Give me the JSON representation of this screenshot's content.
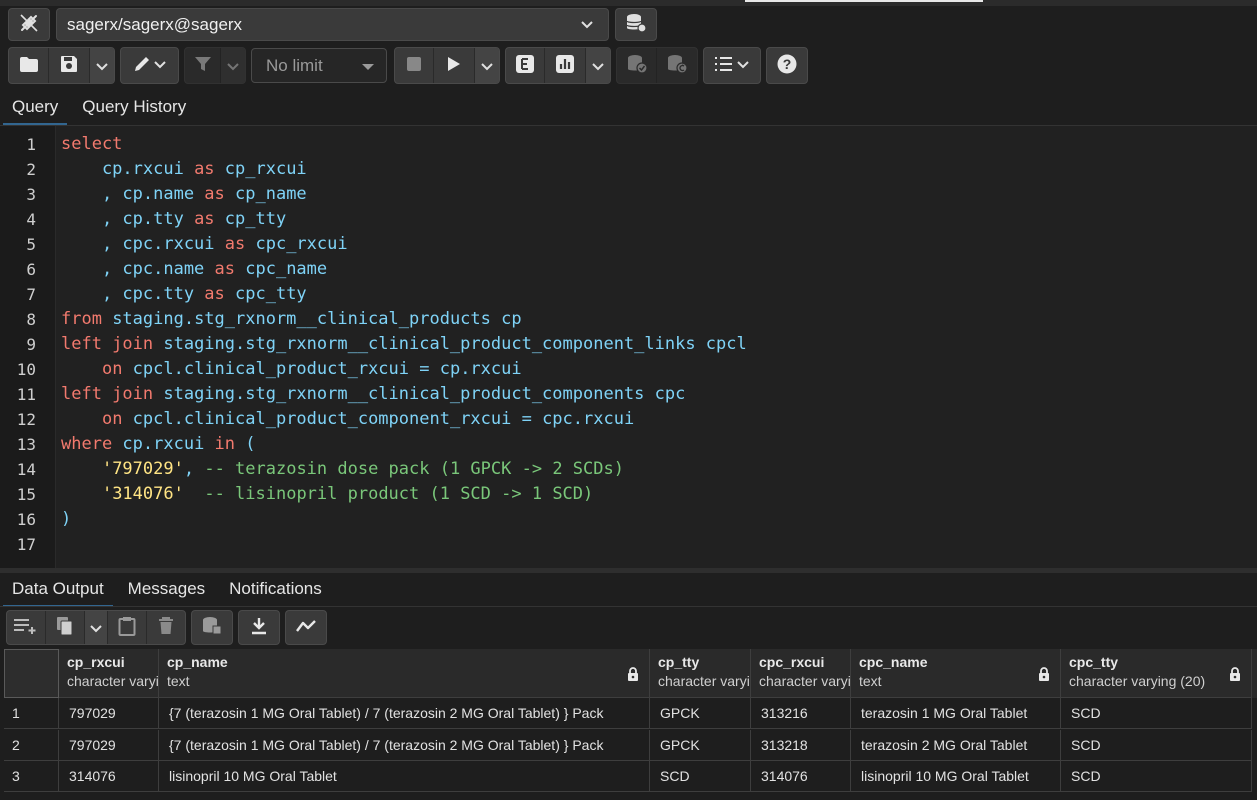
{
  "connection": {
    "label": "sagerx/sagerx@sagerx"
  },
  "toolbar": {
    "limit_label": "No limit"
  },
  "query_tabs": [
    {
      "label": "Query",
      "active": true
    },
    {
      "label": "Query History",
      "active": false
    }
  ],
  "editor": {
    "lines": [
      {
        "n": "1",
        "tokens": [
          {
            "t": "kw",
            "v": "select"
          }
        ]
      },
      {
        "n": "2",
        "tokens": [
          {
            "t": "code",
            "v": "    cp.rxcui "
          },
          {
            "t": "kw",
            "v": "as"
          },
          {
            "t": "code",
            "v": " cp_rxcui"
          }
        ]
      },
      {
        "n": "3",
        "tokens": [
          {
            "t": "code",
            "v": "    , cp.name "
          },
          {
            "t": "kw",
            "v": "as"
          },
          {
            "t": "code",
            "v": " cp_name"
          }
        ]
      },
      {
        "n": "4",
        "tokens": [
          {
            "t": "code",
            "v": "    , cp.tty "
          },
          {
            "t": "kw",
            "v": "as"
          },
          {
            "t": "code",
            "v": " cp_tty"
          }
        ]
      },
      {
        "n": "5",
        "tokens": [
          {
            "t": "code",
            "v": "    , cpc.rxcui "
          },
          {
            "t": "kw",
            "v": "as"
          },
          {
            "t": "code",
            "v": " cpc_rxcui"
          }
        ]
      },
      {
        "n": "6",
        "tokens": [
          {
            "t": "code",
            "v": "    , cpc.name "
          },
          {
            "t": "kw",
            "v": "as"
          },
          {
            "t": "code",
            "v": " cpc_name"
          }
        ]
      },
      {
        "n": "7",
        "tokens": [
          {
            "t": "code",
            "v": "    , cpc.tty "
          },
          {
            "t": "kw",
            "v": "as"
          },
          {
            "t": "code",
            "v": " cpc_tty"
          }
        ]
      },
      {
        "n": "8",
        "tokens": [
          {
            "t": "kw",
            "v": "from"
          },
          {
            "t": "code",
            "v": " staging.stg_rxnorm__clinical_products cp"
          }
        ]
      },
      {
        "n": "9",
        "tokens": [
          {
            "t": "kw",
            "v": "left join"
          },
          {
            "t": "code",
            "v": " staging.stg_rxnorm__clinical_product_component_links cpcl"
          }
        ]
      },
      {
        "n": "10",
        "tokens": [
          {
            "t": "code",
            "v": "    "
          },
          {
            "t": "kw",
            "v": "on"
          },
          {
            "t": "code",
            "v": " cpcl.clinical_product_rxcui = cp.rxcui"
          }
        ]
      },
      {
        "n": "11",
        "tokens": [
          {
            "t": "kw",
            "v": "left join"
          },
          {
            "t": "code",
            "v": " staging.stg_rxnorm__clinical_product_components cpc"
          }
        ]
      },
      {
        "n": "12",
        "tokens": [
          {
            "t": "code",
            "v": "    "
          },
          {
            "t": "kw",
            "v": "on"
          },
          {
            "t": "code",
            "v": " cpcl.clinical_product_component_rxcui = cpc.rxcui"
          }
        ]
      },
      {
        "n": "13",
        "tokens": [
          {
            "t": "kw",
            "v": "where"
          },
          {
            "t": "code",
            "v": " cp.rxcui "
          },
          {
            "t": "kw",
            "v": "in"
          },
          {
            "t": "code",
            "v": " ("
          }
        ]
      },
      {
        "n": "14",
        "tokens": [
          {
            "t": "code",
            "v": "    "
          },
          {
            "t": "str",
            "v": "'797029'"
          },
          {
            "t": "code",
            "v": ", "
          },
          {
            "t": "cm",
            "v": "-- terazosin dose pack (1 GPCK -> 2 SCDs)"
          }
        ]
      },
      {
        "n": "15",
        "tokens": [
          {
            "t": "code",
            "v": "    "
          },
          {
            "t": "str",
            "v": "'314076'"
          },
          {
            "t": "code",
            "v": "  "
          },
          {
            "t": "cm",
            "v": "-- lisinopril product (1 SCD -> 1 SCD)"
          }
        ]
      },
      {
        "n": "16",
        "tokens": [
          {
            "t": "code",
            "v": ")"
          }
        ]
      },
      {
        "n": "17",
        "tokens": []
      }
    ]
  },
  "result_tabs": [
    {
      "label": "Data Output",
      "active": true
    },
    {
      "label": "Messages",
      "active": false
    },
    {
      "label": "Notifications",
      "active": false
    }
  ],
  "grid": {
    "columns": [
      {
        "name": "cp_rxcui",
        "type": "character varying",
        "locked": false
      },
      {
        "name": "cp_name",
        "type": "text",
        "locked": true
      },
      {
        "name": "cp_tty",
        "type": "character varying",
        "locked": false
      },
      {
        "name": "cpc_rxcui",
        "type": "character varying",
        "locked": false
      },
      {
        "name": "cpc_name",
        "type": "text",
        "locked": true
      },
      {
        "name": "cpc_tty",
        "type": "character varying (20)",
        "locked": true
      }
    ],
    "rows": [
      {
        "n": "1",
        "cells": [
          "797029",
          "{7 (terazosin 1 MG Oral Tablet) / 7 (terazosin 2 MG Oral Tablet) } Pack",
          "GPCK",
          "313216",
          "terazosin 1 MG Oral Tablet",
          "SCD"
        ]
      },
      {
        "n": "2",
        "cells": [
          "797029",
          "{7 (terazosin 1 MG Oral Tablet) / 7 (terazosin 2 MG Oral Tablet) } Pack",
          "GPCK",
          "313218",
          "terazosin 2 MG Oral Tablet",
          "SCD"
        ]
      },
      {
        "n": "3",
        "cells": [
          "314076",
          "lisinopril 10 MG Oral Tablet",
          "SCD",
          "314076",
          "lisinopril 10 MG Oral Tablet",
          "SCD"
        ]
      }
    ]
  }
}
